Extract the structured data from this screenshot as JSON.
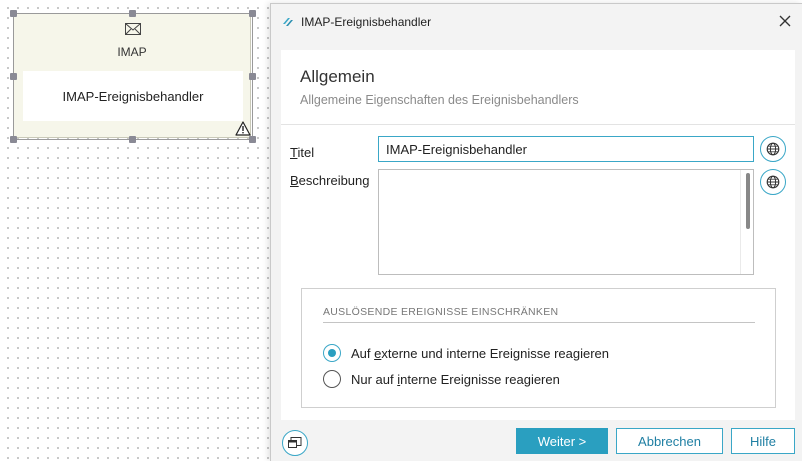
{
  "canvas": {
    "node": {
      "type_label": "IMAP",
      "name": "IMAP-Ereignisbehandler"
    }
  },
  "dialog": {
    "title": "IMAP-Ereignisbehandler",
    "section": {
      "heading": "Allgemein",
      "subheading": "Allgemeine Eigenschaften des Ereignisbehandlers"
    },
    "fields": {
      "title_label_ul": "T",
      "title_label_rest": "itel",
      "title_value": "IMAP-Ereignisbehandler",
      "description_label_ul": "B",
      "description_label_rest": "eschreibung",
      "description_value": ""
    },
    "group": {
      "title": "AUSLÖSENDE EREIGNISSE EINSCHRÄNKEN",
      "options": [
        {
          "pre": "Auf ",
          "ul": "e",
          "post": "xterne und interne Ereignisse reagieren",
          "checked": true
        },
        {
          "pre": "Nur auf ",
          "ul": "i",
          "post": "nterne Ereignisse reagieren",
          "checked": false
        }
      ]
    },
    "buttons": {
      "next": "Weiter >",
      "cancel": "Abbrechen",
      "help": "Hilfe"
    }
  },
  "colors": {
    "accent": "#2a9fc0",
    "node_background": "#f6f6ea",
    "dialog_background": "#f3f3f3"
  }
}
